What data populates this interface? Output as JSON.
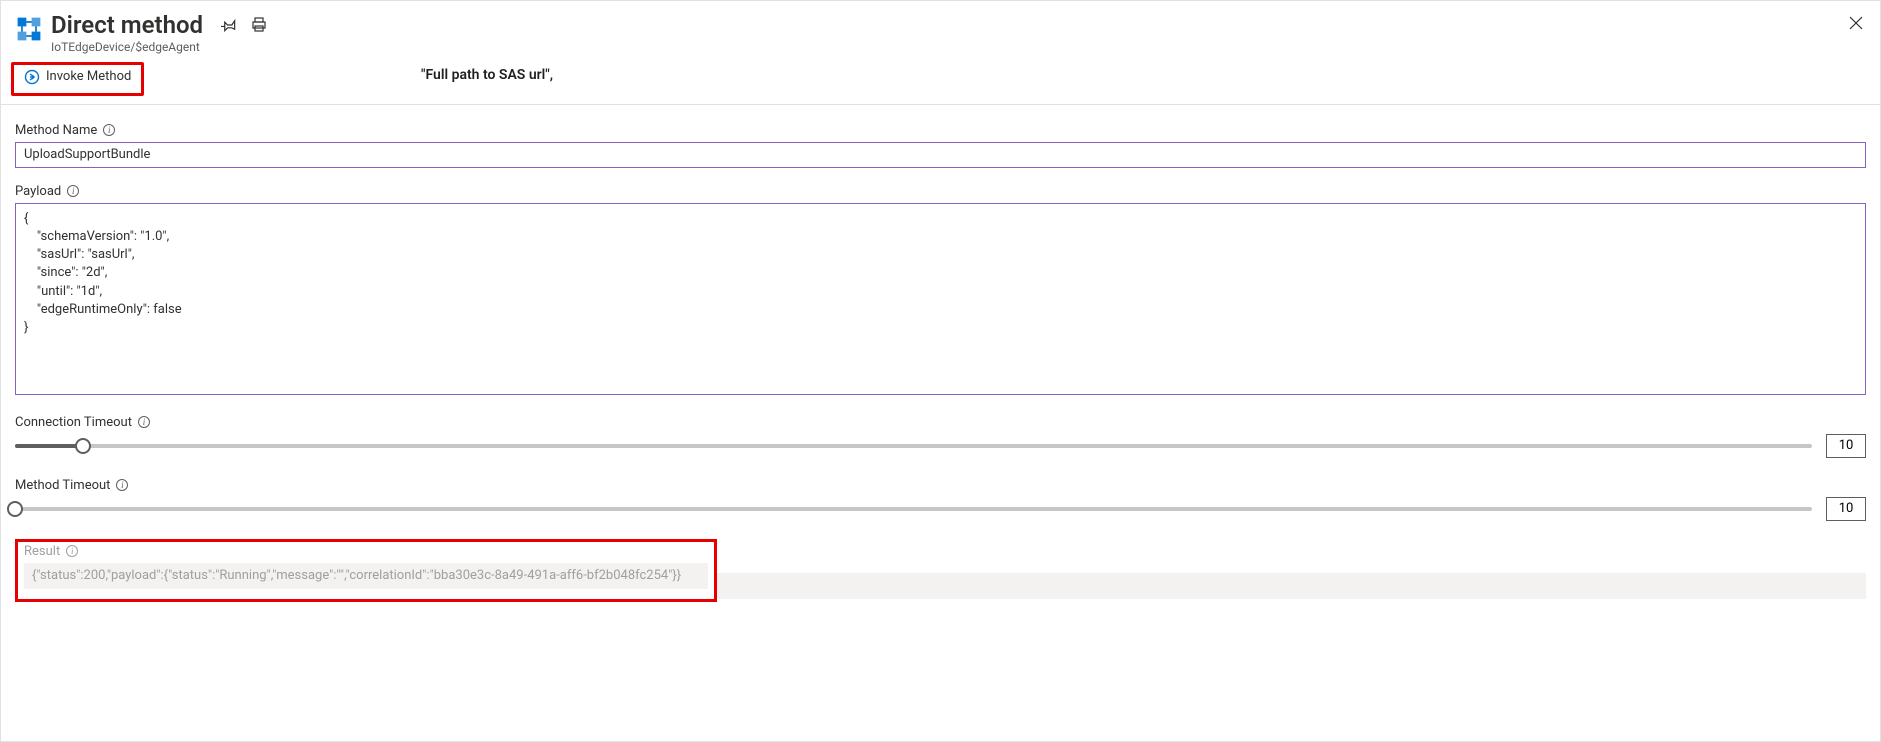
{
  "header": {
    "title": "Direct method",
    "subtitle": "IoTEdgeDevice/$edgeAgent"
  },
  "floating_hint": "\"Full path to SAS url\",",
  "command": {
    "invoke_label": "Invoke Method"
  },
  "fields": {
    "method_name": {
      "label": "Method Name",
      "value": "UploadSupportBundle"
    },
    "payload": {
      "label": "Payload",
      "value": "{\n    \"schemaVersion\": \"1.0\",\n    \"sasUrl\": \"sasUrl\",\n    \"since\": \"2d\",\n    \"until\": \"1d\",\n    \"edgeRuntimeOnly\": false\n}"
    },
    "connection_timeout": {
      "label": "Connection Timeout",
      "value": "10",
      "percent": 3.8
    },
    "method_timeout": {
      "label": "Method Timeout",
      "value": "10",
      "percent": 0
    }
  },
  "result": {
    "label": "Result",
    "value": "{\"status\":200,\"payload\":{\"status\":\"Running\",\"message\":\"\",\"correlationId\":\"bba30e3c-8a49-491a-aff6-bf2b048fc254\"}}"
  }
}
